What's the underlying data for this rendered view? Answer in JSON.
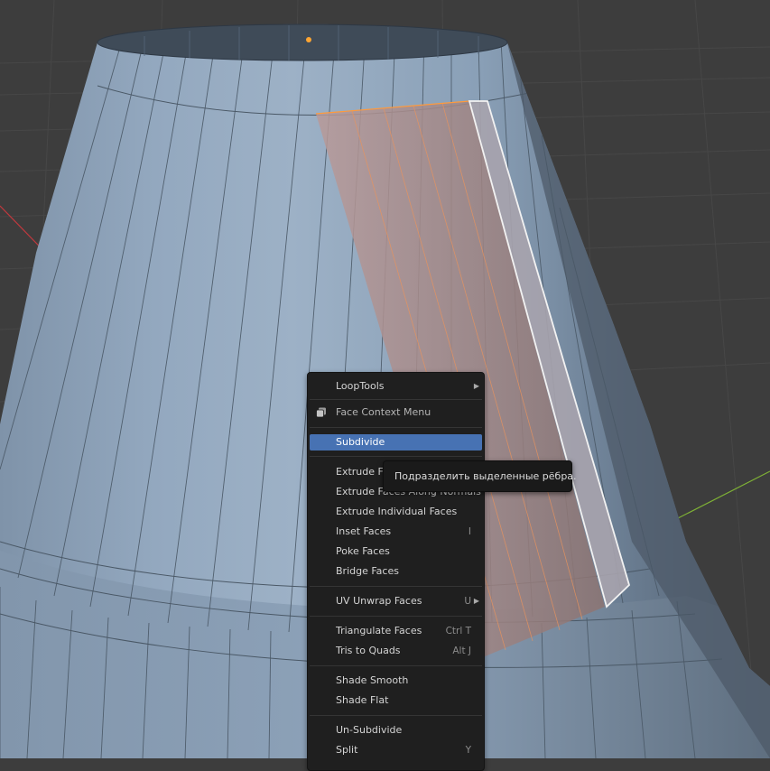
{
  "menu": {
    "items": [
      {
        "label": "LoopTools",
        "shortcut": "",
        "submenu": true
      },
      {
        "label": "Face Context Menu",
        "shortcut": "",
        "icon": "face-context-menu-icon"
      },
      {
        "label": "Subdivide",
        "shortcut": "",
        "active": true
      },
      {
        "label": "Extrude Faces",
        "shortcut": ""
      },
      {
        "label": "Extrude Faces Along Normals",
        "shortcut": ""
      },
      {
        "label": "Extrude Individual Faces",
        "shortcut": ""
      },
      {
        "label": "Inset Faces",
        "shortcut": "I"
      },
      {
        "label": "Poke Faces",
        "shortcut": ""
      },
      {
        "label": "Bridge Faces",
        "shortcut": ""
      },
      {
        "label": "UV Unwrap Faces",
        "shortcut": "U",
        "submenu": true
      },
      {
        "label": "Triangulate Faces",
        "shortcut": "Ctrl T"
      },
      {
        "label": "Tris to Quads",
        "shortcut": "Alt J"
      },
      {
        "label": "Shade Smooth",
        "shortcut": ""
      },
      {
        "label": "Shade Flat",
        "shortcut": ""
      },
      {
        "label": "Un-Subdivide",
        "shortcut": ""
      },
      {
        "label": "Split",
        "shortcut": "Y"
      }
    ]
  },
  "tooltip": {
    "text": "Подразделить выделенные рёбра."
  },
  "colors": {
    "background": "#3d3d3d",
    "mesh": "#8aa1bb",
    "selection": "#c9a09a",
    "selected_edge": "#ff9a3c",
    "active_highlight": "#4772b3",
    "axis_x": "#c0393e",
    "axis_y": "#7fb236"
  }
}
